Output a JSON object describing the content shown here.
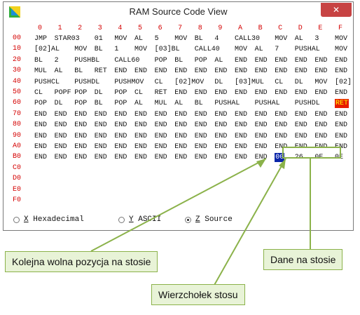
{
  "window": {
    "title": "RAM Source Code View",
    "close_label": "✕",
    "app_icon": "app-icon"
  },
  "col_headers": [
    "0",
    "1",
    "2",
    "3",
    "4",
    "5",
    "6",
    "7",
    "8",
    "9",
    "A",
    "B",
    "C",
    "D",
    "E",
    "F"
  ],
  "row_labels": [
    "00",
    "10",
    "20",
    "30",
    "40",
    "50",
    "60",
    "70",
    "80",
    "90",
    "A0",
    "B0",
    "C0",
    "D0",
    "E0",
    "F0"
  ],
  "rows": [
    [
      [
        0,
        "JMP"
      ],
      [
        1,
        "STAR03"
      ],
      [
        3,
        "01"
      ],
      [
        4,
        "MOV"
      ],
      [
        5,
        "AL"
      ],
      [
        6,
        "5"
      ],
      [
        7,
        "MOV"
      ],
      [
        8,
        "BL"
      ],
      [
        9,
        "4"
      ],
      [
        10,
        "CALL30"
      ],
      [
        12,
        "MOV"
      ],
      [
        13,
        "AL"
      ],
      [
        14,
        "3"
      ],
      [
        15,
        "MOV"
      ]
    ],
    [
      [
        0,
        "[02]AL"
      ],
      [
        2,
        "MOV"
      ],
      [
        3,
        "BL"
      ],
      [
        4,
        "1"
      ],
      [
        5,
        "MOV"
      ],
      [
        6,
        "[03]BL"
      ],
      [
        8,
        "CALL40"
      ],
      [
        10,
        "MOV"
      ],
      [
        11,
        "AL"
      ],
      [
        12,
        "7"
      ],
      [
        13,
        "PUSHAL"
      ],
      [
        15,
        "MOV"
      ]
    ],
    [
      [
        0,
        "BL"
      ],
      [
        1,
        "2"
      ],
      [
        2,
        "PUSHBL"
      ],
      [
        4,
        "CALL60"
      ],
      [
        6,
        "POP"
      ],
      [
        7,
        "BL"
      ],
      [
        8,
        "POP"
      ],
      [
        9,
        "AL"
      ],
      [
        10,
        "END"
      ],
      [
        11,
        "END"
      ],
      [
        12,
        "END"
      ],
      [
        13,
        "END"
      ],
      [
        14,
        "END"
      ],
      [
        15,
        "END"
      ]
    ],
    [
      [
        0,
        "MUL"
      ],
      [
        1,
        "AL"
      ],
      [
        2,
        "BL"
      ],
      [
        3,
        "RET"
      ],
      [
        4,
        "END"
      ],
      [
        5,
        "END"
      ],
      [
        6,
        "END"
      ],
      [
        7,
        "END"
      ],
      [
        8,
        "END"
      ],
      [
        9,
        "END"
      ],
      [
        10,
        "END"
      ],
      [
        11,
        "END"
      ],
      [
        12,
        "END"
      ],
      [
        13,
        "END"
      ],
      [
        14,
        "END"
      ],
      [
        15,
        "END"
      ]
    ],
    [
      [
        0,
        "PUSHCL"
      ],
      [
        2,
        "PUSHDL"
      ],
      [
        4,
        "PUSHMOV"
      ],
      [
        6,
        "CL"
      ],
      [
        7,
        "[02]MOV"
      ],
      [
        9,
        "DL"
      ],
      [
        10,
        "[03]MUL"
      ],
      [
        12,
        "CL"
      ],
      [
        13,
        "DL"
      ],
      [
        14,
        "MOV"
      ],
      [
        15,
        "[02]"
      ]
    ],
    [
      [
        0,
        "CL"
      ],
      [
        1,
        "POPF"
      ],
      [
        2,
        "POP"
      ],
      [
        3,
        "DL"
      ],
      [
        4,
        "POP"
      ],
      [
        5,
        "CL"
      ],
      [
        6,
        "RET"
      ],
      [
        7,
        "END"
      ],
      [
        8,
        "END"
      ],
      [
        9,
        "END"
      ],
      [
        10,
        "END"
      ],
      [
        11,
        "END"
      ],
      [
        12,
        "END"
      ],
      [
        13,
        "END"
      ],
      [
        14,
        "END"
      ],
      [
        15,
        "END"
      ]
    ],
    [
      [
        0,
        "POP"
      ],
      [
        1,
        "DL"
      ],
      [
        2,
        "POP"
      ],
      [
        3,
        "BL"
      ],
      [
        4,
        "POP"
      ],
      [
        5,
        "AL"
      ],
      [
        6,
        "MUL"
      ],
      [
        7,
        "AL"
      ],
      [
        8,
        "BL"
      ],
      [
        9,
        "PUSHAL"
      ],
      [
        11,
        "PUSHAL"
      ],
      [
        13,
        "PUSHDL"
      ],
      [
        15,
        "RET"
      ]
    ],
    [
      [
        0,
        "END"
      ],
      [
        1,
        "END"
      ],
      [
        2,
        "END"
      ],
      [
        3,
        "END"
      ],
      [
        4,
        "END"
      ],
      [
        5,
        "END"
      ],
      [
        6,
        "END"
      ],
      [
        7,
        "END"
      ],
      [
        8,
        "END"
      ],
      [
        9,
        "END"
      ],
      [
        10,
        "END"
      ],
      [
        11,
        "END"
      ],
      [
        12,
        "END"
      ],
      [
        13,
        "END"
      ],
      [
        14,
        "END"
      ],
      [
        15,
        "END"
      ]
    ],
    [
      [
        0,
        "END"
      ],
      [
        1,
        "END"
      ],
      [
        2,
        "END"
      ],
      [
        3,
        "END"
      ],
      [
        4,
        "END"
      ],
      [
        5,
        "END"
      ],
      [
        6,
        "END"
      ],
      [
        7,
        "END"
      ],
      [
        8,
        "END"
      ],
      [
        9,
        "END"
      ],
      [
        10,
        "END"
      ],
      [
        11,
        "END"
      ],
      [
        12,
        "END"
      ],
      [
        13,
        "END"
      ],
      [
        14,
        "END"
      ],
      [
        15,
        "END"
      ]
    ],
    [
      [
        0,
        "END"
      ],
      [
        1,
        "END"
      ],
      [
        2,
        "END"
      ],
      [
        3,
        "END"
      ],
      [
        4,
        "END"
      ],
      [
        5,
        "END"
      ],
      [
        6,
        "END"
      ],
      [
        7,
        "END"
      ],
      [
        8,
        "END"
      ],
      [
        9,
        "END"
      ],
      [
        10,
        "END"
      ],
      [
        11,
        "END"
      ],
      [
        12,
        "END"
      ],
      [
        13,
        "END"
      ],
      [
        14,
        "END"
      ],
      [
        15,
        "END"
      ]
    ],
    [
      [
        0,
        "END"
      ],
      [
        1,
        "END"
      ],
      [
        2,
        "END"
      ],
      [
        3,
        "END"
      ],
      [
        4,
        "END"
      ],
      [
        5,
        "END"
      ],
      [
        6,
        "END"
      ],
      [
        7,
        "END"
      ],
      [
        8,
        "END"
      ],
      [
        9,
        "END"
      ],
      [
        10,
        "END"
      ],
      [
        11,
        "END"
      ],
      [
        12,
        "END"
      ],
      [
        13,
        "END"
      ],
      [
        14,
        "END"
      ],
      [
        15,
        "END"
      ]
    ],
    [
      [
        0,
        "END"
      ],
      [
        1,
        "END"
      ],
      [
        2,
        "END"
      ],
      [
        3,
        "END"
      ],
      [
        4,
        "END"
      ],
      [
        5,
        "END"
      ],
      [
        6,
        "END"
      ],
      [
        7,
        "END"
      ],
      [
        8,
        "END"
      ],
      [
        9,
        "END"
      ],
      [
        10,
        "END"
      ],
      [
        11,
        "END"
      ],
      [
        12,
        "00"
      ],
      [
        13,
        "26"
      ],
      [
        14,
        "0E"
      ],
      [
        15,
        "0E"
      ]
    ],
    [],
    [],
    [],
    []
  ],
  "highlights": {
    "stack_pointer": {
      "row": 11,
      "col": 12,
      "color": "#0a25a8"
    },
    "instruction_pointer": {
      "row": 6,
      "col": 15,
      "color": "#e81c00"
    }
  },
  "radio": {
    "options": [
      {
        "key": "X",
        "label": "Hexadecimal",
        "selected": false
      },
      {
        "key": "Y",
        "label": "ASCII",
        "selected": false
      },
      {
        "key": "Z",
        "label": "Source",
        "selected": true
      }
    ]
  },
  "callouts": {
    "next_free": "Kolejna wolna pozycja na stosie",
    "stack_data": "Dane na stosie",
    "stack_top": "Wierzchołek stosu"
  },
  "colors": {
    "label_red": "#d40000",
    "callout_border": "#8bb24a",
    "callout_fill": "#e8f3d7"
  }
}
